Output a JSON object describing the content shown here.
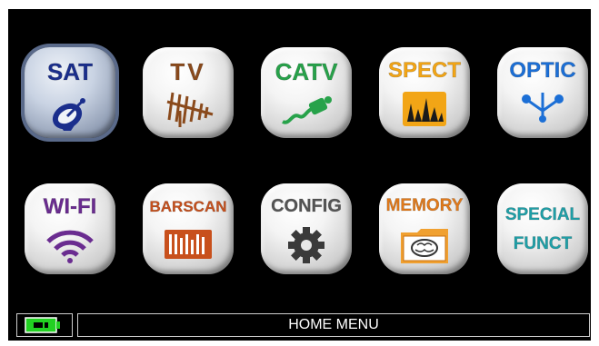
{
  "menu": {
    "items": [
      {
        "id": "sat",
        "label": "SAT",
        "color": "#1a2e8c",
        "icon": "satellite-dish-icon",
        "selected": true
      },
      {
        "id": "tv",
        "label": "TV",
        "color": "#8a4a1c",
        "icon": "tv-antenna-icon"
      },
      {
        "id": "catv",
        "label": "CATV",
        "color": "#27a24a",
        "icon": "coax-cable-icon"
      },
      {
        "id": "spect",
        "label": "SPECT",
        "color": "#f2a516",
        "icon": "spectrum-icon"
      },
      {
        "id": "optic",
        "label": "OPTIC",
        "color": "#1c6fd6",
        "icon": "optical-splitter-icon"
      },
      {
        "id": "wifi",
        "label": "WI-FI",
        "color": "#6a2c90",
        "icon": "wifi-icon"
      },
      {
        "id": "barscan",
        "label": "BARSCAN",
        "color": "#c8501c",
        "icon": "barscan-icon"
      },
      {
        "id": "config",
        "label": "CONFIG",
        "color": "#555555",
        "icon": "gear-icon"
      },
      {
        "id": "memory",
        "label": "MEMORY",
        "color": "#e27a1a",
        "icon": "memory-folder-icon"
      },
      {
        "id": "special",
        "label": "SPECIAL",
        "label2": "FUNCT",
        "color": "#1ea0a8",
        "icon": "special-functions"
      }
    ]
  },
  "status": {
    "title": "HOME MENU",
    "battery_icon": "battery-icon",
    "battery_color": "#22d022"
  }
}
